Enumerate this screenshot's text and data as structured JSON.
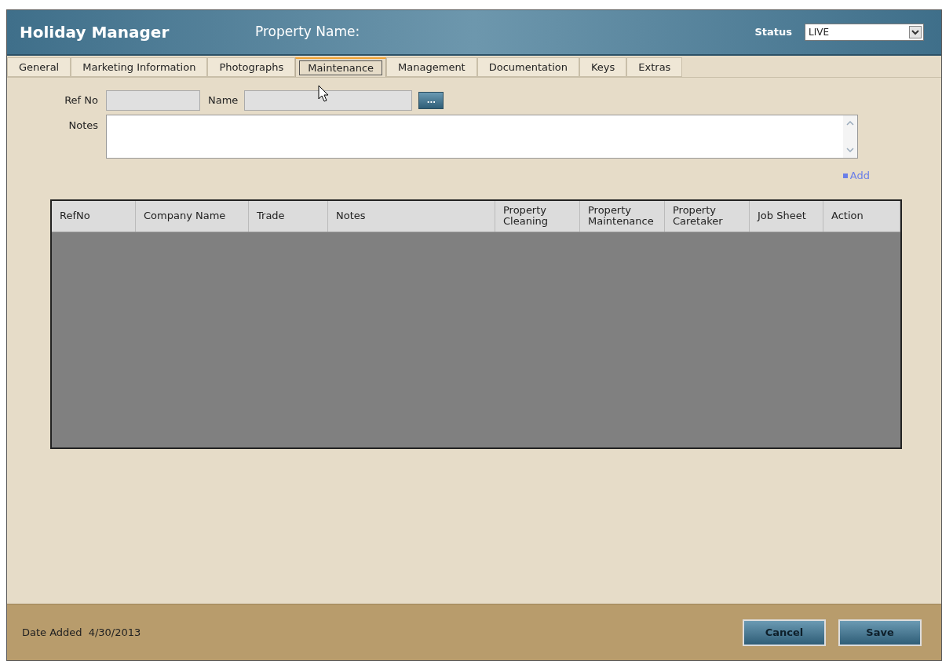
{
  "header": {
    "app_title": "Holiday Manager",
    "property_label": "Property Name:",
    "status_label": "Status",
    "status_value": "LIVE"
  },
  "tabs": [
    {
      "label": "General",
      "selected": false
    },
    {
      "label": "Marketing Information",
      "selected": false
    },
    {
      "label": "Photographs",
      "selected": false
    },
    {
      "label": "Maintenance",
      "selected": true
    },
    {
      "label": "Management",
      "selected": false
    },
    {
      "label": "Documentation",
      "selected": false
    },
    {
      "label": "Keys",
      "selected": false
    },
    {
      "label": "Extras",
      "selected": false
    }
  ],
  "form": {
    "ref_no_label": "Ref No",
    "name_label": "Name",
    "browse_button": "...",
    "notes_label": "Notes",
    "add_link": "Add"
  },
  "table": {
    "columns": [
      "RefNo",
      "Company Name",
      "Trade",
      "Notes",
      "Property Cleaning",
      "Property Maintenance",
      "Property Caretaker",
      "Job Sheet",
      "Action"
    ]
  },
  "footer": {
    "date_label": "Date Added",
    "date_value": "4/30/2013",
    "buttons": [
      "Cancel",
      "Save"
    ]
  }
}
